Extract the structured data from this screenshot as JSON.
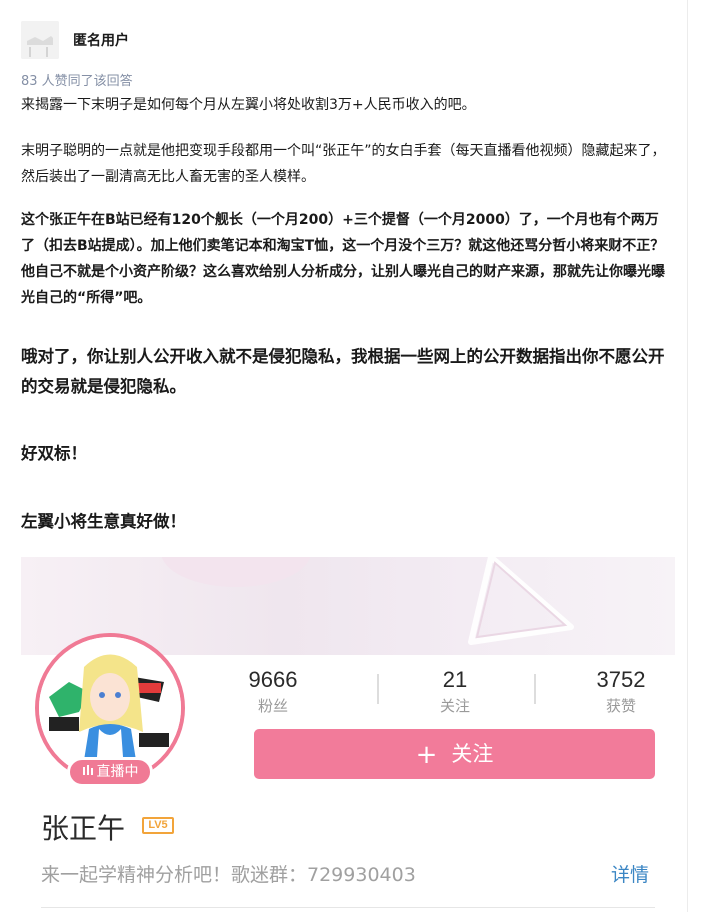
{
  "post": {
    "author": "匿名用户",
    "likes_text": "83 人赞同了该回答",
    "paragraphs": [
      "来揭露一下末明子是如何每个月从左翼小将处收割3万+人民币收入的吧。",
      "末明子聪明的一点就是他把变现手段都用一个叫“张正午”的女白手套（每天直播看他视频）隐藏起来了，然后装出了一副清高无比人畜无害的圣人模样。",
      "这个张正午在B站已经有120个舰长（一个月200）+三个提督（一个月2000）了，一个月也有个两万了（扣去B站提成）。加上他们卖笔记本和淘宝T恤，这一个月没个三万？就这他还骂分哲小将来财不正？他自己不就是个小资产阶级？这么喜欢给别人分析成分，让别人曝光自己的财产来源，那就先让你曝光曝光自己的“所得”吧。",
      "哦对了，你让别人公开收入就不是侵犯隐私，我根据一些网上的公开数据指出你不愿公开的交易就是侵犯隐私。",
      "好双标！",
      "左翼小将生意真好做！"
    ]
  },
  "profile_card": {
    "live_badge": "直播中",
    "stats": [
      {
        "value": "9666",
        "label": "粉丝"
      },
      {
        "value": "21",
        "label": "关注"
      },
      {
        "value": "3752",
        "label": "获赞"
      }
    ],
    "follow_label": "关注",
    "follow_icon": "+",
    "level_badge": "LV5",
    "name": "张正午",
    "signature": "来一起学精神分析吧！歌迷群：729930403",
    "detail_link": "详情",
    "accent_color": "#f27b9a",
    "link_color": "#3b86c4"
  }
}
